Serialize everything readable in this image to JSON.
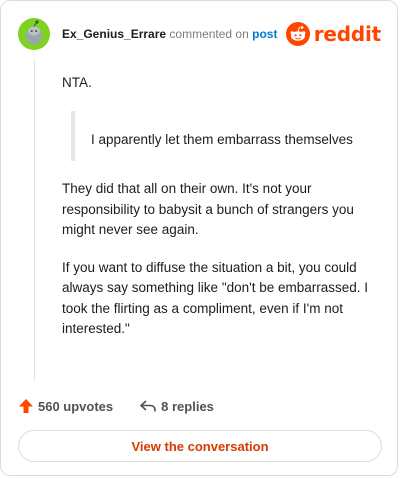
{
  "header": {
    "author": "Ex_Genius_Errare",
    "action_text": "commented on",
    "post_link": "post",
    "brand": "reddit"
  },
  "comment": {
    "greeting": "NTA.",
    "quote": "I apparently let them embarrass themselves",
    "paragraph_1": "They did that all on their own. It's not your responsibility to babysit a bunch of strangers you might never see again.",
    "paragraph_2": "If you want to diffuse the situation a bit, you could always say something like \"don't be embarrassed. I took the flirting as a compliment, even if I'm not interested.\""
  },
  "actions": {
    "upvotes": "560 upvotes",
    "replies": "8 replies"
  },
  "view_button": "View the conversation",
  "colors": {
    "brand": "#ff4500",
    "avatar": "#7ed321",
    "link": "#0079d3",
    "button_text": "#d93a00"
  },
  "icons": [
    "avatar-snoo",
    "reddit-logo",
    "upvote-arrow-icon",
    "reply-arrow-icon"
  ]
}
